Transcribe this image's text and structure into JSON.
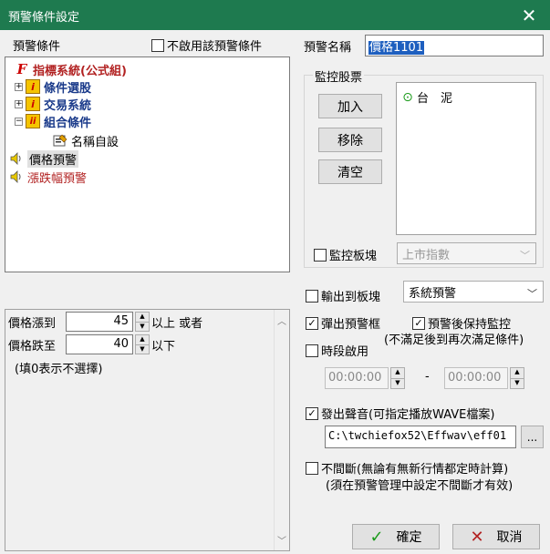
{
  "window": {
    "title": "預警條件設定"
  },
  "left": {
    "header": "預警條件",
    "disable_label": "不啟用該預警條件",
    "tree": {
      "root": "指標系統(公式組)",
      "items": [
        "條件選股",
        "交易系統",
        "組合條件"
      ],
      "subitem": "名稱自設",
      "price_alert": "價格預警",
      "change_alert": "漲跌幅預警"
    },
    "params": {
      "rise_label": "價格漲到",
      "rise_value": "45",
      "rise_suffix": "以上 或者",
      "fall_label": "價格跌至",
      "fall_value": "40",
      "fall_suffix": "以下",
      "note": "(填0表示不選擇)"
    }
  },
  "right": {
    "name_label": "預警名稱",
    "name_value": "價格1101",
    "monitor_group_label": "監控股票",
    "buttons": {
      "add": "加入",
      "remove": "移除",
      "clear": "清空"
    },
    "stocks": [
      "台　泥"
    ],
    "board_label": "監控板塊",
    "board_value": "上市指數",
    "output_label": "輸出到板塊",
    "output_value": "系統預警",
    "popup_label": "彈出預警框",
    "keep_label": "預警後保持監控",
    "keep_note": "(不滿足後到再次滿足條件)",
    "period_label": "時段啟用",
    "time_start": "00:00:00",
    "time_dash": "-",
    "time_end": "00:00:00",
    "sound_label": "發出聲音(可指定播放WAVE檔案)",
    "sound_path": "C:\\twchiefox52\\Effwav\\eff01",
    "browse": "...",
    "continuous_label": "不間斷(無論有無新行情都定時計算)",
    "continuous_note": "(須在預警管理中設定不間斷才有效)",
    "ok": "確定",
    "cancel": "取消"
  },
  "colors": {
    "titlebar": "#1e7a4f",
    "tree_red": "#b22222",
    "tree_blue": "#1a3a8a",
    "name_select": "#1e5fbf"
  }
}
